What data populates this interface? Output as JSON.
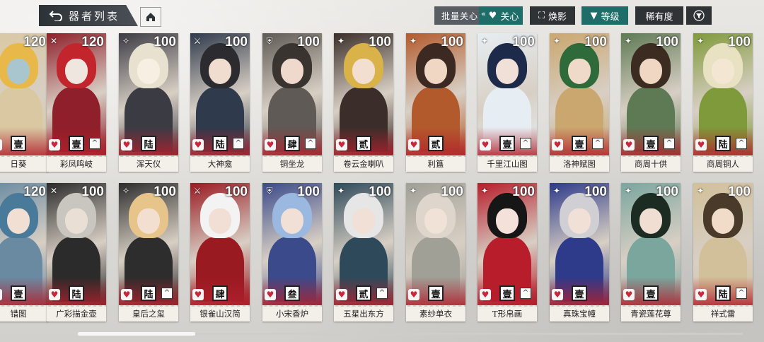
{
  "header": {
    "title": "器者列表",
    "batch_label": "批量关心",
    "batch_chevron": "«"
  },
  "filters": [
    {
      "label": "关心",
      "icon": "heart-icon"
    },
    {
      "label": "焕影",
      "icon": "frame-icon"
    },
    {
      "label": "等级",
      "icon": "triangle-down-icon"
    },
    {
      "label": "稀有度",
      "icon": ""
    }
  ],
  "colors": {
    "accent_teal": "#1f6d68",
    "dark_button": "#2f3336",
    "heart_red": "#c8283a"
  },
  "cards_row1": [
    {
      "name": "日葵",
      "level": "120",
      "rank": "壹",
      "up": false
    },
    {
      "name": "彩凤鸣岐",
      "level": "120",
      "rank": "壹",
      "up": true
    },
    {
      "name": "浑天仪",
      "level": "100",
      "rank": "陆",
      "up": false
    },
    {
      "name": "大神龛",
      "level": "100",
      "rank": "陆",
      "up": true
    },
    {
      "name": "铜坐龙",
      "level": "100",
      "rank": "肆",
      "up": true
    },
    {
      "name": "卷云金喇叭",
      "level": "100",
      "rank": "贰",
      "up": false
    },
    {
      "name": "利簋",
      "level": "100",
      "rank": "贰",
      "up": false
    },
    {
      "name": "千里江山图",
      "level": "100",
      "rank": "壹",
      "up": true
    },
    {
      "name": "洛神赋图",
      "level": "100",
      "rank": "壹",
      "up": true
    },
    {
      "name": "商周十供",
      "level": "100",
      "rank": "壹",
      "up": true
    },
    {
      "name": "商周铜人",
      "level": "100",
      "rank": "陆",
      "up": true
    }
  ],
  "cards_row2": [
    {
      "name": "错图",
      "level": "120",
      "rank": "壹",
      "up": false
    },
    {
      "name": "广彩描金壶",
      "level": "100",
      "rank": "陆",
      "up": false
    },
    {
      "name": "皇后之玺",
      "level": "100",
      "rank": "陆",
      "up": true
    },
    {
      "name": "银雀山汉简",
      "level": "100",
      "rank": "肆",
      "up": false
    },
    {
      "name": "小宋香炉",
      "level": "100",
      "rank": "叁",
      "up": false
    },
    {
      "name": "五星出东方",
      "level": "100",
      "rank": "贰",
      "up": true
    },
    {
      "name": "素纱单衣",
      "level": "100",
      "rank": "壹",
      "up": false
    },
    {
      "name": "T形帛画",
      "level": "100",
      "rank": "壹",
      "up": true
    },
    {
      "name": "真珠宝幢",
      "level": "100",
      "rank": "壹",
      "up": false
    },
    {
      "name": "青瓷莲花尊",
      "level": "100",
      "rank": "壹",
      "up": false
    },
    {
      "name": "祥式雷",
      "level": "100",
      "rank": "陆",
      "up": true
    }
  ]
}
